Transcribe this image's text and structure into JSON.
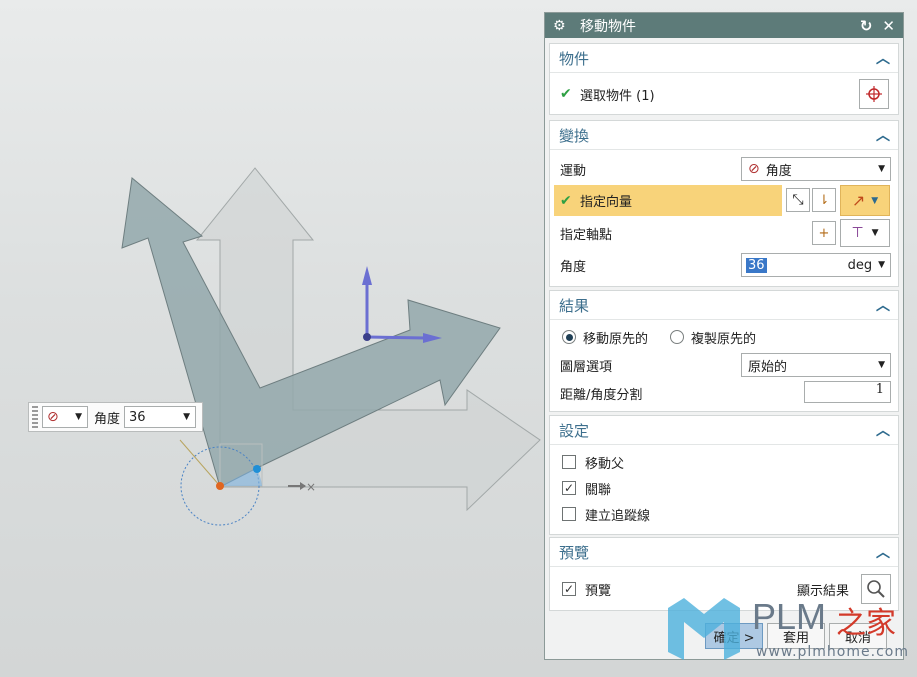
{
  "floating_bar": {
    "label": "角度",
    "value": "36"
  },
  "dialog": {
    "title": "移動物件",
    "sections": {
      "object": {
        "title": "物件",
        "select_label": "選取物件 (1)"
      },
      "transform": {
        "title": "變換",
        "motion_label": "運動",
        "motion_value": "角度",
        "vector_label": "指定向量",
        "pivot_label": "指定軸點",
        "angle_label": "角度",
        "angle_value": "36",
        "angle_unit": "deg"
      },
      "result": {
        "title": "結果",
        "move_original": "移動原先的",
        "copy_original": "複製原先的",
        "move_selected": true,
        "layer_label": "圖層選項",
        "layer_value": "原始的",
        "split_label": "距離/角度分割",
        "split_value": "1"
      },
      "settings": {
        "title": "設定",
        "move_parent": "移動父",
        "move_parent_checked": false,
        "associative": "關聯",
        "associative_checked": true,
        "create_trace": "建立追蹤線",
        "create_trace_checked": false
      },
      "preview": {
        "title": "預覽",
        "preview_label": "預覽",
        "preview_checked": true,
        "show_result": "顯示結果"
      }
    },
    "buttons": {
      "ok": "確定 >",
      "apply": "套用",
      "cancel": "取消"
    }
  },
  "watermark": {
    "brand": "PLM",
    "brand_suffix": "之家",
    "url": "www.plmhome.com"
  },
  "colors": {
    "accent": "#5d7b79",
    "highlight_row": "#f8d37a",
    "section_title": "#3d6f8d"
  }
}
